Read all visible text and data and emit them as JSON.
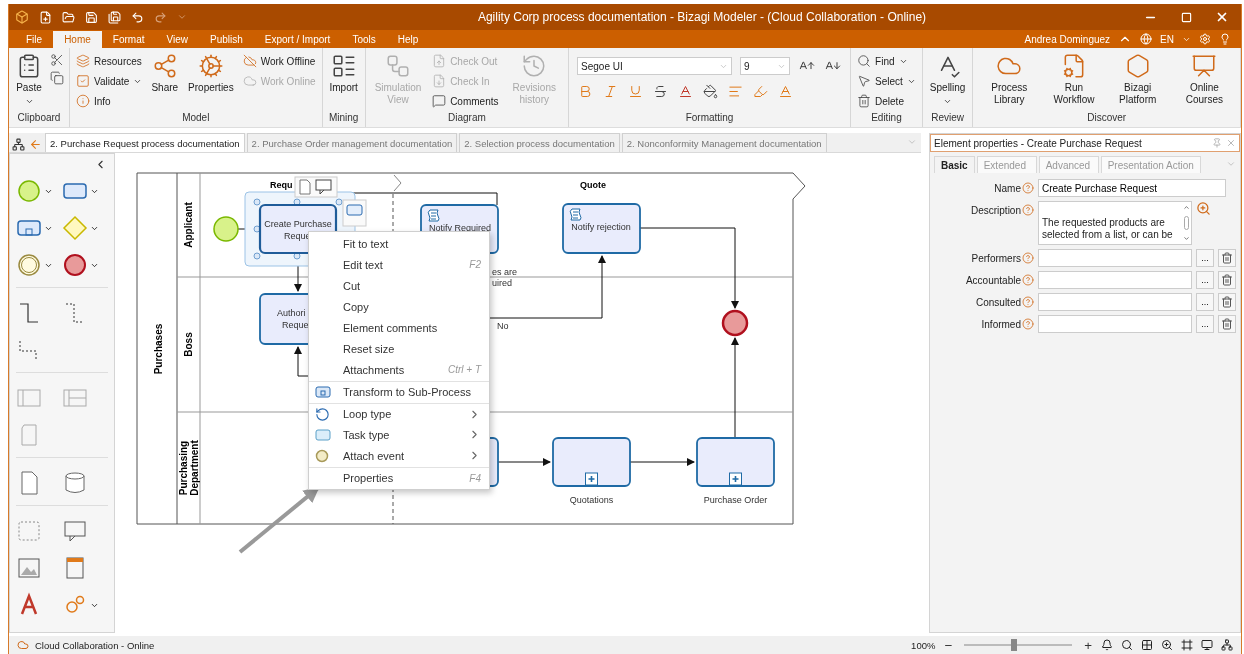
{
  "window": {
    "title": "Agility Corp process documentation - Bizagi Modeler - (Cloud Collaboration - Online)"
  },
  "menu_tabs": [
    {
      "label": "File",
      "selected": false
    },
    {
      "label": "Home",
      "selected": true
    },
    {
      "label": "Format",
      "selected": false
    },
    {
      "label": "View",
      "selected": false
    },
    {
      "label": "Publish",
      "selected": false
    },
    {
      "label": "Export / Import",
      "selected": false
    },
    {
      "label": "Tools",
      "selected": false
    },
    {
      "label": "Help",
      "selected": false
    }
  ],
  "user": {
    "name": "Andrea Dominguez",
    "language": "EN"
  },
  "ribbon": [
    {
      "label": "Clipboard",
      "columns": [
        {
          "kind": "large",
          "items": [
            {
              "label": "Paste",
              "dropdown": true,
              "disabled": false
            }
          ]
        },
        {
          "kind": "icons",
          "items": [
            {
              "disabled": false
            },
            {
              "disabled": false
            }
          ]
        }
      ]
    },
    {
      "label": "Model",
      "columns": [
        {
          "kind": "stack",
          "items": [
            {
              "label": "Resources",
              "dropdown": false,
              "disabled": false
            },
            {
              "label": "Validate",
              "dropdown": true,
              "disabled": false
            },
            {
              "label": "Info",
              "dropdown": false,
              "disabled": false
            }
          ]
        },
        {
          "kind": "large",
          "items": [
            {
              "label": "Share",
              "dropdown": false,
              "disabled": false
            }
          ]
        },
        {
          "kind": "large",
          "items": [
            {
              "label": "Properties",
              "dropdown": false,
              "disabled": false
            }
          ]
        },
        {
          "kind": "stack",
          "items": [
            {
              "label": "Work Offline",
              "dropdown": false,
              "disabled": false
            },
            {
              "label": "Work Online",
              "dropdown": false,
              "disabled": true
            }
          ]
        }
      ]
    },
    {
      "label": "Mining",
      "columns": [
        {
          "kind": "large",
          "items": [
            {
              "label": "Import",
              "dropdown": false,
              "disabled": false
            }
          ]
        }
      ]
    },
    {
      "label": "Diagram",
      "columns": [
        {
          "kind": "large",
          "items": [
            {
              "label": "Simulation View",
              "dropdown": false,
              "disabled": true
            }
          ]
        },
        {
          "kind": "stack",
          "items": [
            {
              "label": "Check Out",
              "dropdown": false,
              "disabled": true
            },
            {
              "label": "Check In",
              "dropdown": false,
              "disabled": true
            },
            {
              "label": "Comments",
              "dropdown": false,
              "disabled": false
            }
          ]
        },
        {
          "kind": "large",
          "items": [
            {
              "label": "Revisions history",
              "dropdown": false,
              "disabled": true
            }
          ]
        }
      ]
    },
    {
      "label": "Formatting",
      "columns": [
        {
          "kind": "formatting",
          "font": "Segoe UI",
          "size": "9"
        }
      ]
    },
    {
      "label": "Editing",
      "columns": [
        {
          "kind": "stack",
          "items": [
            {
              "label": "Find",
              "dropdown": true,
              "disabled": false
            },
            {
              "label": "Select",
              "dropdown": true,
              "disabled": false
            },
            {
              "label": "Delete",
              "dropdown": false,
              "disabled": false
            }
          ]
        }
      ]
    },
    {
      "label": "Review",
      "columns": [
        {
          "kind": "large",
          "items": [
            {
              "label": "Spelling",
              "dropdown": true,
              "disabled": false
            }
          ]
        }
      ]
    },
    {
      "label": "Discover",
      "columns": [
        {
          "kind": "large",
          "items": [
            {
              "label": "Process Library",
              "dropdown": false,
              "disabled": false
            }
          ]
        },
        {
          "kind": "large",
          "items": [
            {
              "label": "Run Workflow",
              "dropdown": false,
              "disabled": false
            }
          ]
        },
        {
          "kind": "large",
          "items": [
            {
              "label": "Bizagi Platform",
              "dropdown": false,
              "disabled": false
            }
          ]
        },
        {
          "kind": "large",
          "items": [
            {
              "label": "Online Courses",
              "dropdown": false,
              "disabled": false
            }
          ]
        }
      ]
    }
  ],
  "doc_tabs": [
    {
      "label": "2. Purchase Request process documentation",
      "selected": true
    },
    {
      "label": "2. Purchase Order management documentation",
      "selected": false
    },
    {
      "label": "2. Selection process documentation",
      "selected": false
    },
    {
      "label": "2. Nonconformity Management documentation",
      "selected": false
    }
  ],
  "diagram": {
    "pool": "Purchases",
    "lanes": [
      {
        "lines": [
          "Applicant"
        ]
      },
      {
        "lines": [
          "Boss"
        ]
      },
      {
        "lines": [
          "Purchasing",
          "Department"
        ]
      }
    ],
    "phases": [
      "Requ",
      "Quote"
    ],
    "tasks": [
      {
        "kind": "task",
        "lines": [
          "Create Purchase",
          "Reque"
        ],
        "selected": true
      },
      {
        "kind": "script",
        "lines": [
          "Notify Required"
        ],
        "selected": false
      },
      {
        "kind": "script",
        "lines": [
          "Notify rejection"
        ],
        "selected": false
      },
      {
        "kind": "task",
        "lines": [
          "Authori",
          "Reque"
        ],
        "selected": false
      },
      {
        "kind": "task",
        "selected": false
      },
      {
        "kind": "subprocess",
        "caption": "Quotations",
        "selected": false
      },
      {
        "kind": "subprocess",
        "caption": "Purchase Order",
        "selected": false
      }
    ],
    "events": [
      {
        "kind": "start"
      },
      {
        "kind": "end"
      }
    ],
    "flow_labels": [
      {
        "lines": [
          "es are",
          "uired"
        ]
      },
      {
        "lines": [
          "No"
        ]
      }
    ]
  },
  "context_menu": [
    {
      "kind": "plain",
      "label": "Fit to text",
      "separator_before": false,
      "submenu": false
    },
    {
      "kind": "plain",
      "label": "Edit text",
      "shortcut": "F2",
      "separator_before": false,
      "submenu": false
    },
    {
      "kind": "plain",
      "label": "Cut",
      "separator_before": false,
      "submenu": false
    },
    {
      "kind": "plain",
      "label": "Copy",
      "separator_before": false,
      "submenu": false
    },
    {
      "kind": "plain",
      "label": "Element comments",
      "separator_before": false,
      "submenu": false
    },
    {
      "kind": "plain",
      "label": "Reset size",
      "separator_before": false,
      "submenu": false
    },
    {
      "kind": "plain",
      "label": "Attachments",
      "shortcut": "Ctrl + T",
      "separator_before": false,
      "submenu": false
    },
    {
      "kind": "transform",
      "label": "Transform to Sub-Process",
      "separator_before": true,
      "submenu": false
    },
    {
      "kind": "loop",
      "label": "Loop type",
      "separator_before": true,
      "submenu": true
    },
    {
      "kind": "tasktype",
      "label": "Task type",
      "separator_before": false,
      "submenu": true
    },
    {
      "kind": "attach",
      "label": "Attach event",
      "separator_before": false,
      "submenu": true
    },
    {
      "kind": "plain",
      "label": "Properties",
      "shortcut": "F4",
      "separator_before": true,
      "submenu": false
    }
  ],
  "properties": {
    "title": "Element properties - Create Purchase Request",
    "tabs": [
      {
        "label": "Basic",
        "selected": true
      },
      {
        "label": "Extended",
        "selected": false
      },
      {
        "label": "Advanced",
        "selected": false
      },
      {
        "label": "Presentation Action",
        "selected": false
      }
    ],
    "fields": [
      {
        "kind": "text",
        "label": "Name",
        "value": "Create Purchase Request"
      },
      {
        "kind": "textarea",
        "label": "Description",
        "value": "The requested products are selected from a list, or can be"
      },
      {
        "kind": "people",
        "label": "Performers",
        "button": "..."
      },
      {
        "kind": "people",
        "label": "Accountable",
        "button": "..."
      },
      {
        "kind": "people",
        "label": "Consulted",
        "button": "..."
      },
      {
        "kind": "people",
        "label": "Informed",
        "button": "..."
      }
    ]
  },
  "status_bar": {
    "text": "Cloud Collaboration - Online",
    "zoom": {
      "reading": "100%",
      "minus": "−",
      "plus": "+",
      "level": 0.46
    }
  }
}
